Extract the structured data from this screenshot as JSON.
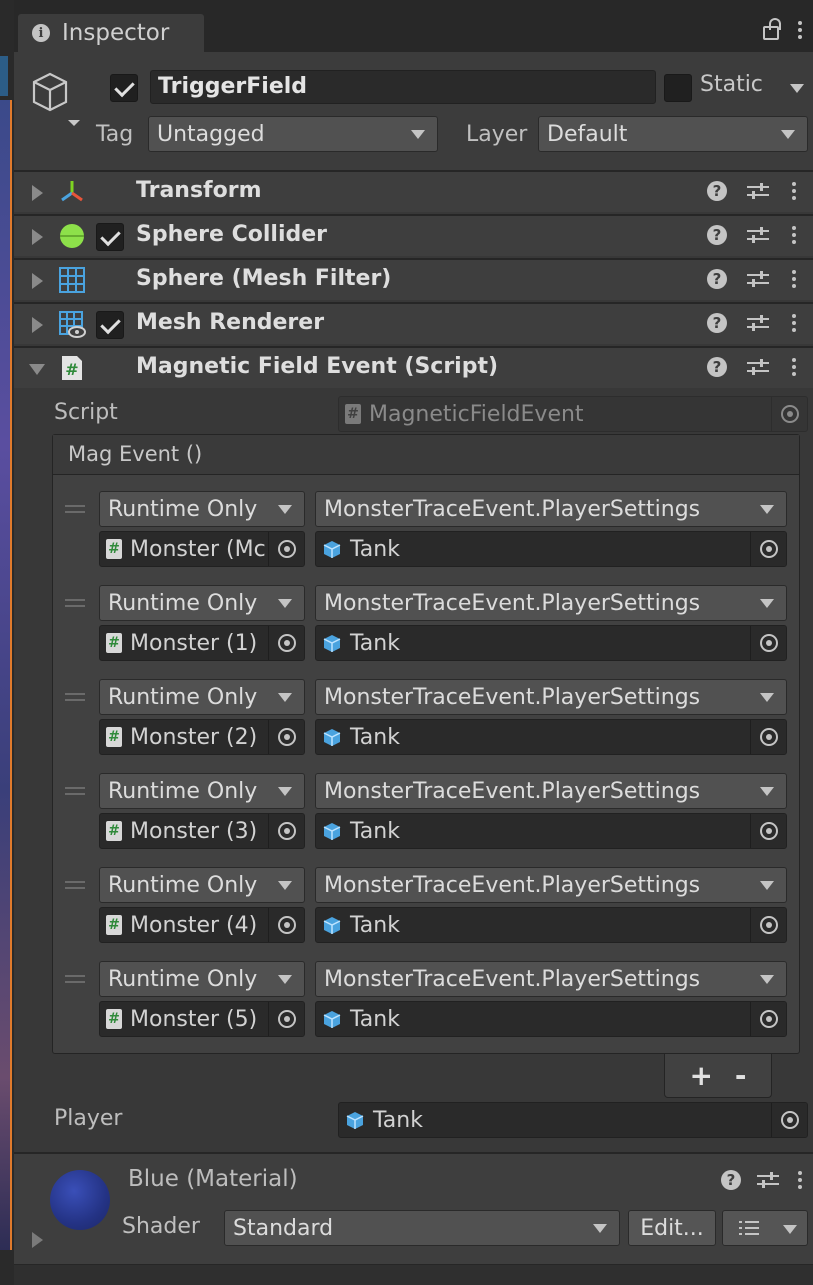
{
  "tab": {
    "title": "Inspector"
  },
  "header": {
    "active": true,
    "name": "TriggerField",
    "static_label": "Static",
    "tag_label": "Tag",
    "tag_value": "Untagged",
    "layer_label": "Layer",
    "layer_value": "Default"
  },
  "components": [
    {
      "name": "Transform",
      "icon": "transform-icon",
      "has_toggle": false,
      "expanded": false
    },
    {
      "name": "Sphere Collider",
      "icon": "sphere-collider-icon",
      "has_toggle": true,
      "expanded": false
    },
    {
      "name": "Sphere (Mesh Filter)",
      "icon": "mesh-filter-icon",
      "has_toggle": false,
      "expanded": false
    },
    {
      "name": "Mesh Renderer",
      "icon": "mesh-renderer-icon",
      "has_toggle": true,
      "expanded": false
    },
    {
      "name": "Magnetic Field Event (Script)",
      "icon": "script-icon",
      "has_toggle": false,
      "expanded": true
    }
  ],
  "script": {
    "label": "Script",
    "value": "MagneticFieldEvent"
  },
  "event": {
    "title": "Mag Event ()",
    "entries": [
      {
        "mode": "Runtime Only",
        "function": "MonsterTraceEvent.PlayerSettings",
        "target": "Monster (Mc",
        "argument": "Tank"
      },
      {
        "mode": "Runtime Only",
        "function": "MonsterTraceEvent.PlayerSettings",
        "target": "Monster (1)",
        "argument": "Tank"
      },
      {
        "mode": "Runtime Only",
        "function": "MonsterTraceEvent.PlayerSettings",
        "target": "Monster (2)",
        "argument": "Tank"
      },
      {
        "mode": "Runtime Only",
        "function": "MonsterTraceEvent.PlayerSettings",
        "target": "Monster (3)",
        "argument": "Tank"
      },
      {
        "mode": "Runtime Only",
        "function": "MonsterTraceEvent.PlayerSettings",
        "target": "Monster (4)",
        "argument": "Tank"
      },
      {
        "mode": "Runtime Only",
        "function": "MonsterTraceEvent.PlayerSettings",
        "target": "Monster (5)",
        "argument": "Tank"
      }
    ],
    "add_label": "+",
    "remove_label": "-"
  },
  "player": {
    "label": "Player",
    "value": "Tank"
  },
  "material": {
    "name": "Blue (Material)",
    "shader_label": "Shader",
    "shader_value": "Standard",
    "edit_label": "Edit...",
    "color": "#2a3a9a"
  },
  "colors": {
    "panel": "#383838",
    "header": "#3c3c3c",
    "field": "#2a2a2a",
    "script_green": "#2f8a3a"
  }
}
